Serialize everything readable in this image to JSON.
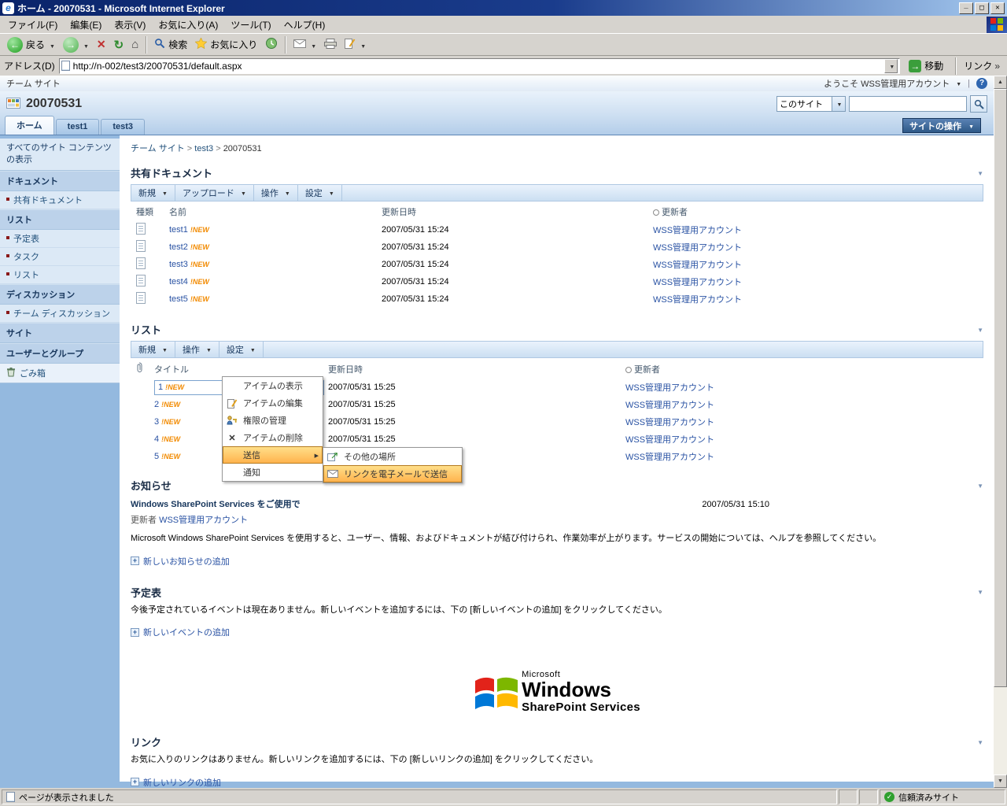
{
  "window": {
    "title": "ホーム - 20070531 - Microsoft Internet Explorer",
    "menu": [
      "ファイル(F)",
      "編集(E)",
      "表示(V)",
      "お気に入り(A)",
      "ツール(T)",
      "ヘルプ(H)"
    ]
  },
  "toolbar": {
    "back": "戻る",
    "search": "検索",
    "favorites": "お気に入り"
  },
  "address": {
    "label": "アドレス(D)",
    "url": "http://n-002/test3/20070531/default.aspx",
    "go": "移動",
    "links": "リンク"
  },
  "status": {
    "left": "ページが表示されました",
    "zone": "信頼済みサイト"
  },
  "sp": {
    "topbar_left": "チーム サイト",
    "welcome": "ようこそ WSS管理用アカウント",
    "title": "20070531",
    "search_scope": "このサイト",
    "tabs": [
      "ホーム",
      "test1",
      "test3"
    ],
    "site_actions": "サイトの操作"
  },
  "sidebar": {
    "view_all": "すべてのサイト コンテンツの表示",
    "sections": [
      {
        "header": "ドキュメント",
        "items": [
          "共有ドキュメント"
        ]
      },
      {
        "header": "リスト",
        "items": [
          "予定表",
          "タスク",
          "リスト"
        ]
      },
      {
        "header": "ディスカッション",
        "items": [
          "チーム ディスカッション"
        ]
      },
      {
        "header": "サイト",
        "items": []
      },
      {
        "header": "ユーザーとグループ",
        "items": []
      }
    ],
    "recycle": "ごみ箱"
  },
  "breadcrumb": [
    "チーム サイト",
    "test3",
    "20070531"
  ],
  "new_badge": "!NEW",
  "docs": {
    "title": "共有ドキュメント",
    "menus": [
      "新規",
      "アップロード",
      "操作",
      "設定"
    ],
    "cols": [
      "種類",
      "名前",
      "更新日時",
      "更新者"
    ],
    "rows": [
      {
        "name": "test1",
        "modified": "2007/05/31 15:24",
        "by": "WSS管理用アカウント"
      },
      {
        "name": "test2",
        "modified": "2007/05/31 15:24",
        "by": "WSS管理用アカウント"
      },
      {
        "name": "test3",
        "modified": "2007/05/31 15:24",
        "by": "WSS管理用アカウント"
      },
      {
        "name": "test4",
        "modified": "2007/05/31 15:24",
        "by": "WSS管理用アカウント"
      },
      {
        "name": "test5",
        "modified": "2007/05/31 15:24",
        "by": "WSS管理用アカウント"
      }
    ]
  },
  "list": {
    "title": "リスト",
    "menus": [
      "新規",
      "操作",
      "設定"
    ],
    "cols": [
      "タイトル",
      "更新日時",
      "更新者"
    ],
    "rows": [
      {
        "title": "1",
        "modified": "2007/05/31 15:25",
        "by": "WSS管理用アカウント"
      },
      {
        "title": "2",
        "modified": "2007/05/31 15:25",
        "by": "WSS管理用アカウント"
      },
      {
        "title": "3",
        "modified": "2007/05/31 15:25",
        "by": "WSS管理用アカウント"
      },
      {
        "title": "4",
        "modified": "2007/05/31 15:25",
        "by": "WSS管理用アカウント"
      },
      {
        "title": "5",
        "modified": "2007/05/31 15:25",
        "by": "WSS管理用アカウント"
      }
    ]
  },
  "ecb": {
    "items": [
      "アイテムの表示",
      "アイテムの編集",
      "権限の管理",
      "アイテムの削除",
      "送信",
      "通知"
    ],
    "submenu": [
      "その他の場所",
      "リンクを電子メールで送信"
    ]
  },
  "ann": {
    "title": "お知らせ",
    "item_title": "Windows SharePoint Services をご使用で",
    "date": "2007/05/31 15:10",
    "by_label": "更新者",
    "by": "WSS管理用アカウント",
    "body": "Microsoft Windows SharePoint Services を使用すると、ユーザー、情報、およびドキュメントが結び付けられ、作業効率が上がります。サービスの開始については、ヘルプを参照してください。",
    "add": "新しいお知らせの追加"
  },
  "cal": {
    "title": "予定表",
    "empty": "今後予定されているイベントは現在ありません。新しいイベントを追加するには、下の [新しいイベントの追加] をクリックしてください。",
    "add": "新しいイベントの追加"
  },
  "lnk": {
    "title": "リンク",
    "empty": "お気に入りのリンクはありません。新しいリンクを追加するには、下の [新しいリンクの追加] をクリックしてください。",
    "add": "新しいリンクの追加"
  },
  "logo": {
    "microsoft": "Microsoft",
    "windows": "Windows",
    "product": "SharePoint Services"
  },
  "colors": {
    "titlebar_blue": "#0A246A",
    "accent_link": "#2952A3",
    "menu_highlight": "#FFB14A",
    "nav_background": "#94B9DF"
  }
}
